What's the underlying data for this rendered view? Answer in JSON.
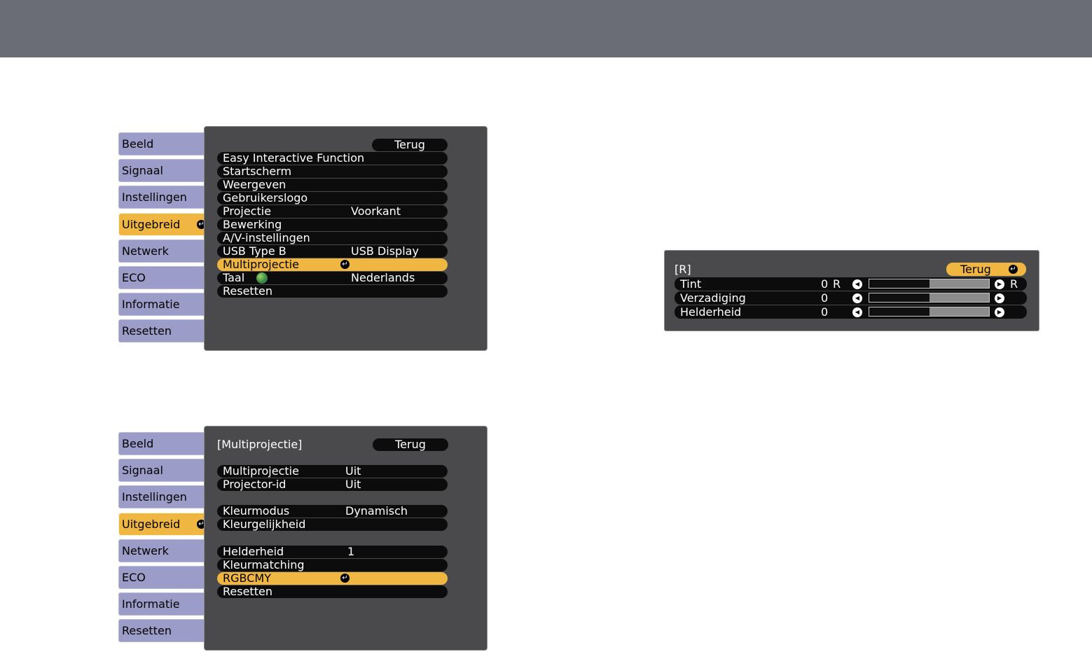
{
  "menu1": {
    "tabs": [
      {
        "label": "Beeld",
        "active": false
      },
      {
        "label": "Signaal",
        "active": false
      },
      {
        "label": "Instellingen",
        "active": false
      },
      {
        "label": "Uitgebreid",
        "active": true
      },
      {
        "label": "Netwerk",
        "active": false
      },
      {
        "label": "ECO",
        "active": false
      },
      {
        "label": "Informatie",
        "active": false
      },
      {
        "label": "Resetten",
        "active": false
      }
    ],
    "back_label": "Terug",
    "items": [
      {
        "label": "Easy Interactive Function",
        "value": ""
      },
      {
        "label": "Startscherm",
        "value": ""
      },
      {
        "label": "Weergeven",
        "value": ""
      },
      {
        "label": "Gebruikerslogo",
        "value": ""
      },
      {
        "label": "Projectie",
        "value": "Voorkant"
      },
      {
        "label": "Bewerking",
        "value": ""
      },
      {
        "label": "A/V-instellingen",
        "value": ""
      },
      {
        "label": "USB Type B",
        "value": "USB Display"
      },
      {
        "label": "Multiprojectie",
        "value": "",
        "selected": true
      },
      {
        "label": "Taal",
        "value": "Nederlands",
        "icon": "globe-icon"
      },
      {
        "label": "Resetten",
        "value": ""
      }
    ]
  },
  "menu2": {
    "tabs": [
      {
        "label": "Beeld",
        "active": false
      },
      {
        "label": "Signaal",
        "active": false
      },
      {
        "label": "Instellingen",
        "active": false
      },
      {
        "label": "Uitgebreid",
        "active": true
      },
      {
        "label": "Netwerk",
        "active": false
      },
      {
        "label": "ECO",
        "active": false
      },
      {
        "label": "Informatie",
        "active": false
      },
      {
        "label": "Resetten",
        "active": false
      }
    ],
    "breadcrumb": "[Multiprojectie]",
    "back_label": "Terug",
    "items": [
      {
        "label": "Multiprojectie",
        "value": "Uit"
      },
      {
        "label": "Projector-id",
        "value": "Uit"
      },
      {
        "label": "Kleurmodus",
        "value": "Dynamisch"
      },
      {
        "label": "Kleurgelijkheid",
        "value": ""
      },
      {
        "label": "Helderheid",
        "value": "1"
      },
      {
        "label": "Kleurmatching",
        "value": ""
      },
      {
        "label": "RGBCMY",
        "value": "",
        "selected": true
      },
      {
        "label": "Resetten",
        "value": ""
      }
    ]
  },
  "adjust": {
    "breadcrumb": "[R]",
    "back_label": "Terug",
    "rows": [
      {
        "label": "Tint",
        "value": "0",
        "left_label": "R",
        "right_label": "R",
        "level": 0.5
      },
      {
        "label": "Verzadiging",
        "value": "0",
        "left_label": "",
        "right_label": "",
        "level": 0.5
      },
      {
        "label": "Helderheid",
        "value": "0",
        "left_label": "",
        "right_label": "",
        "level": 0.5
      }
    ]
  },
  "icons": {
    "enter": "enter-icon",
    "globe": "globe-icon",
    "arrow_left": "arrow-left-icon",
    "arrow_right": "arrow-right-icon"
  },
  "colors": {
    "topbar": "#6a6d75",
    "tab": "#9c9cc8",
    "active": "#f0b642",
    "panel": "#4a4a4c",
    "row": "#0c0c0c"
  }
}
